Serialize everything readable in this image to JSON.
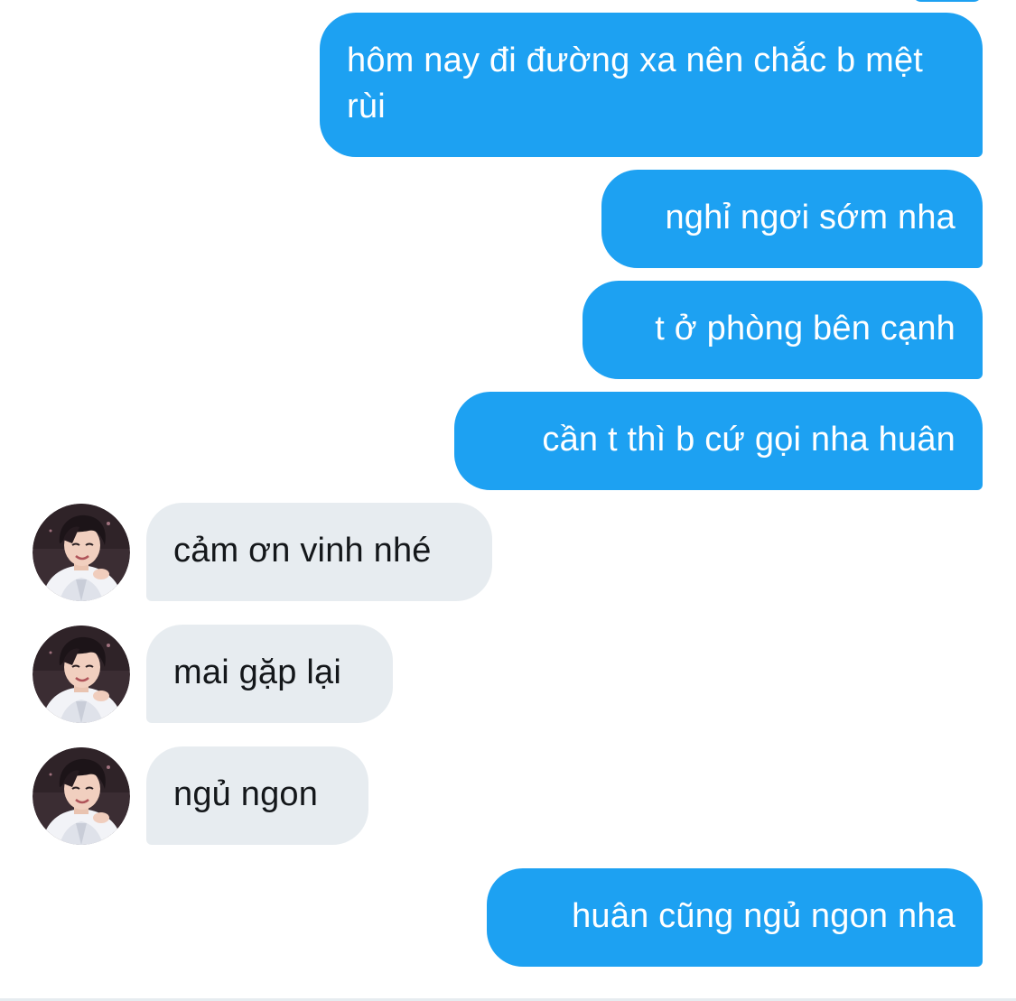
{
  "colors": {
    "sent_bubble": "#1da1f2",
    "received_bubble": "#e7ecf0",
    "received_text": "#14171a"
  },
  "avatar": {
    "icon": "person-photo-avatar"
  },
  "messages": [
    {
      "direction": "sent",
      "text": "hôm nay đi đường xa nên chắc b mệt rùi"
    },
    {
      "direction": "sent",
      "text": "nghỉ ngơi sớm nha"
    },
    {
      "direction": "sent",
      "text": "t ở phòng bên cạnh"
    },
    {
      "direction": "sent",
      "text": "cần t thì b cứ gọi nha huân"
    },
    {
      "direction": "received",
      "text": "cảm ơn vinh nhé"
    },
    {
      "direction": "received",
      "text": "mai gặp lại"
    },
    {
      "direction": "received",
      "text": "ngủ ngon"
    },
    {
      "direction": "sent",
      "text": "huân cũng ngủ ngon nha"
    }
  ]
}
